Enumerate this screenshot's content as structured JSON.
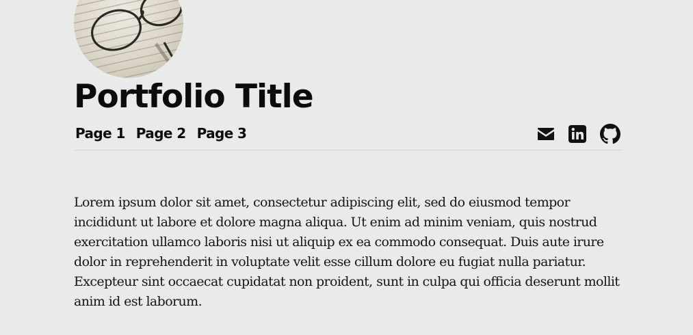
{
  "header": {
    "title": "Portfolio Title",
    "avatar_icon": "glasses-on-newspaper-photo"
  },
  "nav": {
    "items": [
      {
        "label": "Page 1"
      },
      {
        "label": "Page 2"
      },
      {
        "label": "Page 3"
      }
    ]
  },
  "social": {
    "icons": [
      "envelope-icon",
      "linkedin-icon",
      "github-icon"
    ],
    "color": "#111111"
  },
  "main": {
    "paragraph": "Lorem ipsum dolor sit amet, consectetur adipiscing elit, sed do eiusmod tempor incididunt ut labore et dolore magna aliqua. Ut enim ad minim veniam, quis nostrud exercitation ullamco laboris nisi ut aliquip ex ea commodo consequat. Duis aute irure dolor in reprehenderit in voluptate velit esse cillum dolore eu fugiat nulla pariatur. Excepteur sint occaecat cupidatat non proident, sunt in culpa qui officia deserunt mollit anim id est laborum."
  },
  "colors": {
    "background": "#e9eaea",
    "text": "#111111",
    "divider": "#d5d6d6"
  }
}
